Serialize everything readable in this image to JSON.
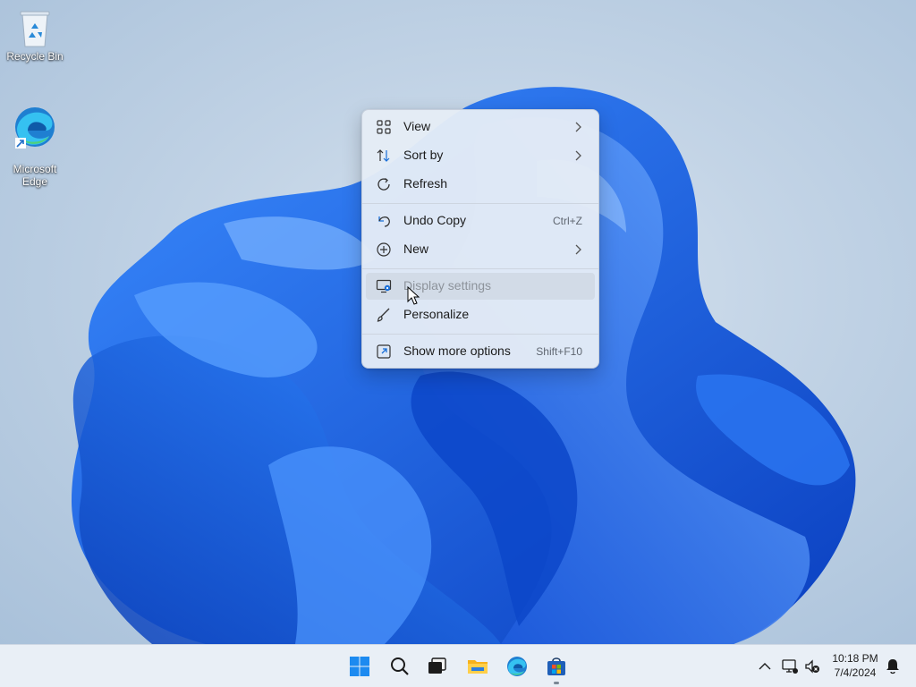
{
  "desktop": {
    "icons": [
      {
        "label": "Recycle Bin",
        "icon": "recycle-bin-icon"
      },
      {
        "label": "Microsoft\nEdge",
        "icon": "edge-icon"
      }
    ]
  },
  "context_menu": {
    "items": [
      {
        "label": "View",
        "icon": "grid-icon",
        "submenu": true
      },
      {
        "label": "Sort by",
        "icon": "sort-icon",
        "submenu": true
      },
      {
        "label": "Refresh",
        "icon": "refresh-icon"
      },
      {
        "label": "Undo Copy",
        "icon": "undo-icon",
        "shortcut": "Ctrl+Z"
      },
      {
        "label": "New",
        "icon": "plus-circle-icon",
        "submenu": true
      },
      {
        "label": "Display settings",
        "icon": "display-settings-icon",
        "state": "hovered"
      },
      {
        "label": "Personalize",
        "icon": "brush-icon"
      },
      {
        "label": "Show more options",
        "icon": "open-in-icon",
        "shortcut": "Shift+F10"
      }
    ]
  },
  "taskbar": {
    "apps": [
      {
        "name": "Start",
        "icon": "windows-start-icon"
      },
      {
        "name": "Search",
        "icon": "search-icon"
      },
      {
        "name": "Task View",
        "icon": "task-view-icon"
      },
      {
        "name": "File Explorer",
        "icon": "folder-icon"
      },
      {
        "name": "Microsoft Edge",
        "icon": "edge-icon"
      },
      {
        "name": "Microsoft Store",
        "icon": "store-icon",
        "active": true
      }
    ],
    "tray": {
      "icons": [
        "chevron-up-icon",
        "network-icon",
        "volume-muted-icon",
        "notification-icon"
      ],
      "time": "10:18 PM",
      "date": "7/4/2024"
    }
  },
  "colors": {
    "accent": "#0067c0",
    "bloom_blue": "#1a6fe8",
    "menu_background": "#e5ecf6"
  }
}
